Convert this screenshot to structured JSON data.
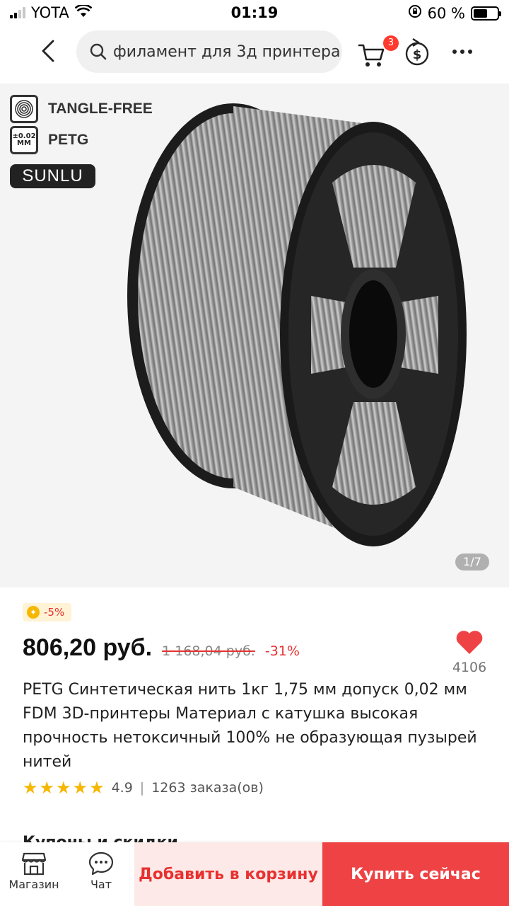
{
  "status_bar": {
    "carrier": "YOTA",
    "time": "01:19",
    "battery_text": "60 %",
    "battery_level_percent": 60
  },
  "header": {
    "search_query": "филамент для 3д принтера",
    "cart_count": "3",
    "icons": {
      "back": "chevron-left-icon",
      "search": "search-icon",
      "cart": "cart-icon",
      "coins": "coin-exchange-icon",
      "more": "more-dots-icon"
    }
  },
  "product_image": {
    "badges": [
      {
        "icon_text": "",
        "label": "TANGLE-FREE"
      },
      {
        "icon_text": "±0.02 MM",
        "label": "PETG"
      }
    ],
    "brand": "SUNLU",
    "counter": "1/7"
  },
  "pricing": {
    "coin_discount": "-5%",
    "price": "806,20 руб.",
    "old_price": "1 168,04 руб.",
    "discount_percent": "-31%",
    "wishlist_count": "4106"
  },
  "product": {
    "title": "PETG Синтетическая нить 1кг 1,75 мм допуск 0,02 мм FDM 3D-принтеры Материал с катушка высокая прочность нетоксичный 100% не образующая пузырей нитей",
    "rating": "4.9",
    "stars": 5,
    "orders": "1263 заказа(ов)"
  },
  "sections": {
    "coupons_title": "Купоны и скидки"
  },
  "bottom_bar": {
    "store_label": "Магазин",
    "chat_label": "Чат",
    "add_to_cart": "Добавить в корзину",
    "buy_now": "Купить сейчас"
  },
  "colors": {
    "accent_red": "#ee4244",
    "add_cart_bg": "#fde9e8",
    "star": "#f5b700"
  }
}
